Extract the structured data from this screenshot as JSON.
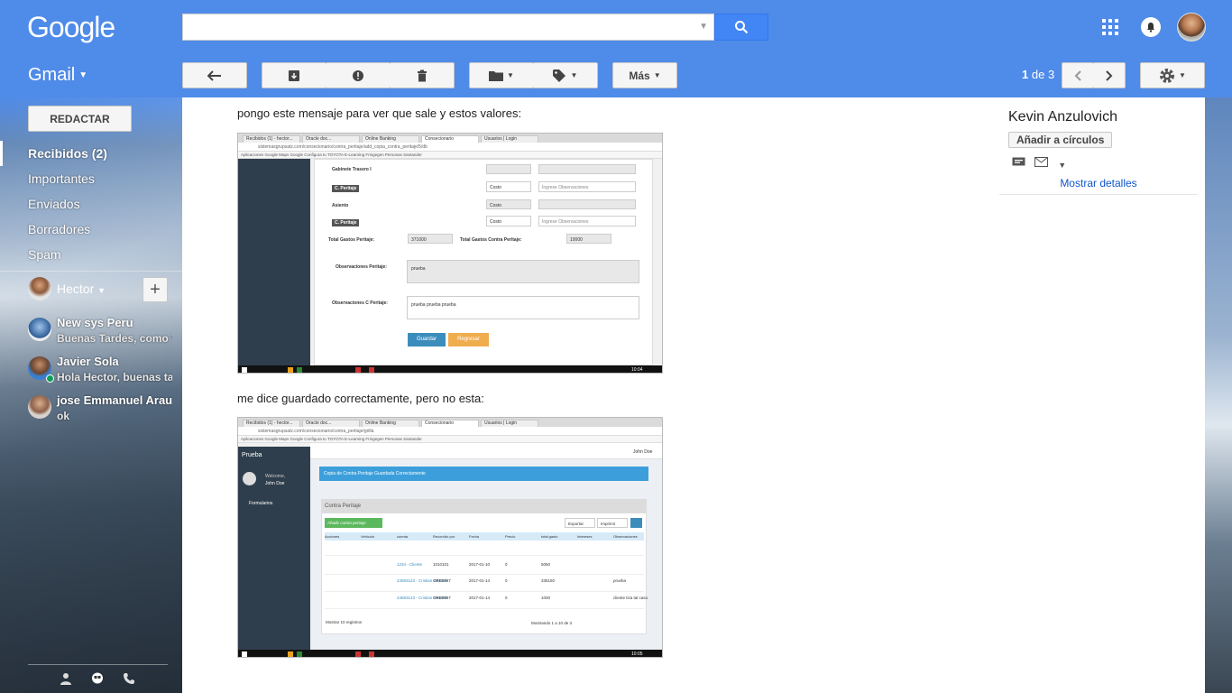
{
  "header": {
    "logo": "Google",
    "search_value": "",
    "app_label": "Gmail"
  },
  "toolbar": {
    "more_label": "Más",
    "page_current": "1",
    "page_sep": "de",
    "page_total": "3"
  },
  "sidebar": {
    "compose_label": "REDACTAR",
    "items": [
      {
        "label": "Recibidos (2)"
      },
      {
        "label": "Importantes"
      },
      {
        "label": "Enviados"
      },
      {
        "label": "Borradores"
      },
      {
        "label": "Spam"
      }
    ],
    "user_name": "Hector",
    "add_label": "+",
    "contacts": [
      {
        "name": "New sys Peru",
        "status": "Buenas Tardes, como V"
      },
      {
        "name": "Javier Sola",
        "status": "Hola Hector, buenas tar"
      },
      {
        "name": "jose Emmanuel Arau",
        "status": "ok"
      }
    ]
  },
  "message": {
    "text1": "pongo este mensaje para ver que sale y estos valores:",
    "text2": "me dice guardado correctamente, pero no esta:"
  },
  "shot1": {
    "tabs": [
      "Recibidos (1) - hector...",
      "Oracle doc...",
      "Online Banking",
      "Consecionario",
      "Usuarios | Login"
    ],
    "url": "sistemasgrupsatz.com/consecionario/contra_peritaje/add_copia_contra_peritaje/5/db",
    "bookmarks": "Aplicaciones   Google Maps   Google   Configura tu TOYOTA   E-Learning Fringegen   Personas Santander",
    "row1_label": "Gabinete Trasero I",
    "btn_cperitaje": "C. Peritaje",
    "row2_label": "Asiento",
    "costo": "Costo",
    "obs_placeholder": "Ingrese Observaciones",
    "total_gastos": "Total Gastos Peritaje:",
    "total_gastos_val": "371000",
    "total_contra": "Total Gastos Contra Peritaje:",
    "total_contra_val": "10000",
    "obs_peritaje": "Observaciones Peritaje:",
    "obs_peritaje_val": "prueba",
    "obs_c_peritaje": "Observaciones C Peritaje:",
    "obs_c_peritaje_val": "prueba prueba prueba",
    "btn_guardar": "Guardar",
    "btn_regresar": "Regresar",
    "clock": "10:04"
  },
  "shot2": {
    "url": "sistemasgrupsatz.com/consecionario/contra_peritaje/grilla",
    "app": "Prueba",
    "welcome": "Welcome,",
    "user": "John Doe",
    "menu": "Formularios",
    "alert": "Copia de Contra Peritaje Guardada Correctamente",
    "panel_title": "Contra Peritaje",
    "btn_add": "Añadir contra peritaje",
    "btn_export": "Exportar",
    "btn_print": "Imprimir",
    "cols": [
      "Acciones",
      "Vehiculo",
      "cuenta",
      "Recorrido por",
      "Fecha",
      "Precio",
      "total gasto",
      "Intereses",
      "Observaciones"
    ],
    "rows": [
      {
        "c": "1234 - Cliente",
        "r": "1010101",
        "f": "2017-01-10",
        "p": "0",
        "t": "5050",
        "o": ""
      },
      {
        "c": "24583123 - Cristian Gastelli",
        "r": "ORE0997",
        "f": "2017-01-14",
        "p": "0",
        "t": "335150",
        "o": "prueba"
      },
      {
        "c": "24583123 - Cristian Gastelli",
        "r": "ORE0997",
        "f": "2017-01-14",
        "p": "0",
        "t": "1000",
        "o": "cliente tiza tal caso"
      }
    ],
    "footer": "Mostrando 1 a 10 de 3",
    "show": "Mostrar",
    "show_val": "10",
    "reg": "registros",
    "clock": "10:05"
  },
  "right_panel": {
    "name": "Kevin Anzulovich",
    "add_circles": "Añadir a círculos",
    "details": "Mostrar detalles"
  },
  "colors": {
    "accent": "#4285f4",
    "top_bg": "#4f8be8"
  }
}
